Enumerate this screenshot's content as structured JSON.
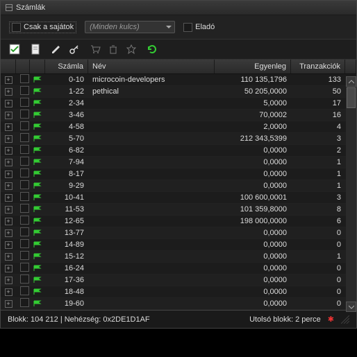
{
  "window": {
    "title": "Számlák"
  },
  "filters": {
    "own_only_label": "Csak a sajátok",
    "keys_placeholder": "(Minden kulcs)",
    "seller_label": "Eladó"
  },
  "columns": {
    "szamla": "Számla",
    "nev": "Név",
    "egyenleg": "Egyenleg",
    "tranzakciok": "Tranzakciók"
  },
  "rows": [
    {
      "szamla": "0-10",
      "nev": "microcoin-developers",
      "egyenleg": "110 135,1796",
      "tr": "133"
    },
    {
      "szamla": "1-22",
      "nev": "pethical",
      "egyenleg": "50 205,0000",
      "tr": "50"
    },
    {
      "szamla": "2-34",
      "nev": "",
      "egyenleg": "5,0000",
      "tr": "17"
    },
    {
      "szamla": "3-46",
      "nev": "",
      "egyenleg": "70,0002",
      "tr": "16"
    },
    {
      "szamla": "4-58",
      "nev": "",
      "egyenleg": "2,0000",
      "tr": "4"
    },
    {
      "szamla": "5-70",
      "nev": "",
      "egyenleg": "212 343,5399",
      "tr": "3"
    },
    {
      "szamla": "6-82",
      "nev": "",
      "egyenleg": "0,0000",
      "tr": "2"
    },
    {
      "szamla": "7-94",
      "nev": "",
      "egyenleg": "0,0000",
      "tr": "1"
    },
    {
      "szamla": "8-17",
      "nev": "",
      "egyenleg": "0,0000",
      "tr": "1"
    },
    {
      "szamla": "9-29",
      "nev": "",
      "egyenleg": "0,0000",
      "tr": "1"
    },
    {
      "szamla": "10-41",
      "nev": "",
      "egyenleg": "100 600,0001",
      "tr": "3"
    },
    {
      "szamla": "11-53",
      "nev": "",
      "egyenleg": "101 359,8000",
      "tr": "8"
    },
    {
      "szamla": "12-65",
      "nev": "",
      "egyenleg": "198 000,0000",
      "tr": "6"
    },
    {
      "szamla": "13-77",
      "nev": "",
      "egyenleg": "0,0000",
      "tr": "0"
    },
    {
      "szamla": "14-89",
      "nev": "",
      "egyenleg": "0,0000",
      "tr": "0"
    },
    {
      "szamla": "15-12",
      "nev": "",
      "egyenleg": "0,0000",
      "tr": "1"
    },
    {
      "szamla": "16-24",
      "nev": "",
      "egyenleg": "0,0000",
      "tr": "0"
    },
    {
      "szamla": "17-36",
      "nev": "",
      "egyenleg": "0,0000",
      "tr": "0"
    },
    {
      "szamla": "18-48",
      "nev": "",
      "egyenleg": "0,0000",
      "tr": "0"
    },
    {
      "szamla": "19-60",
      "nev": "",
      "egyenleg": "0,0000",
      "tr": "0"
    }
  ],
  "status": {
    "left": "Blokk: 104 212 | Nehézség: 0x2DE1D1AF",
    "right": "Utolsó blokk: 2 perce"
  }
}
